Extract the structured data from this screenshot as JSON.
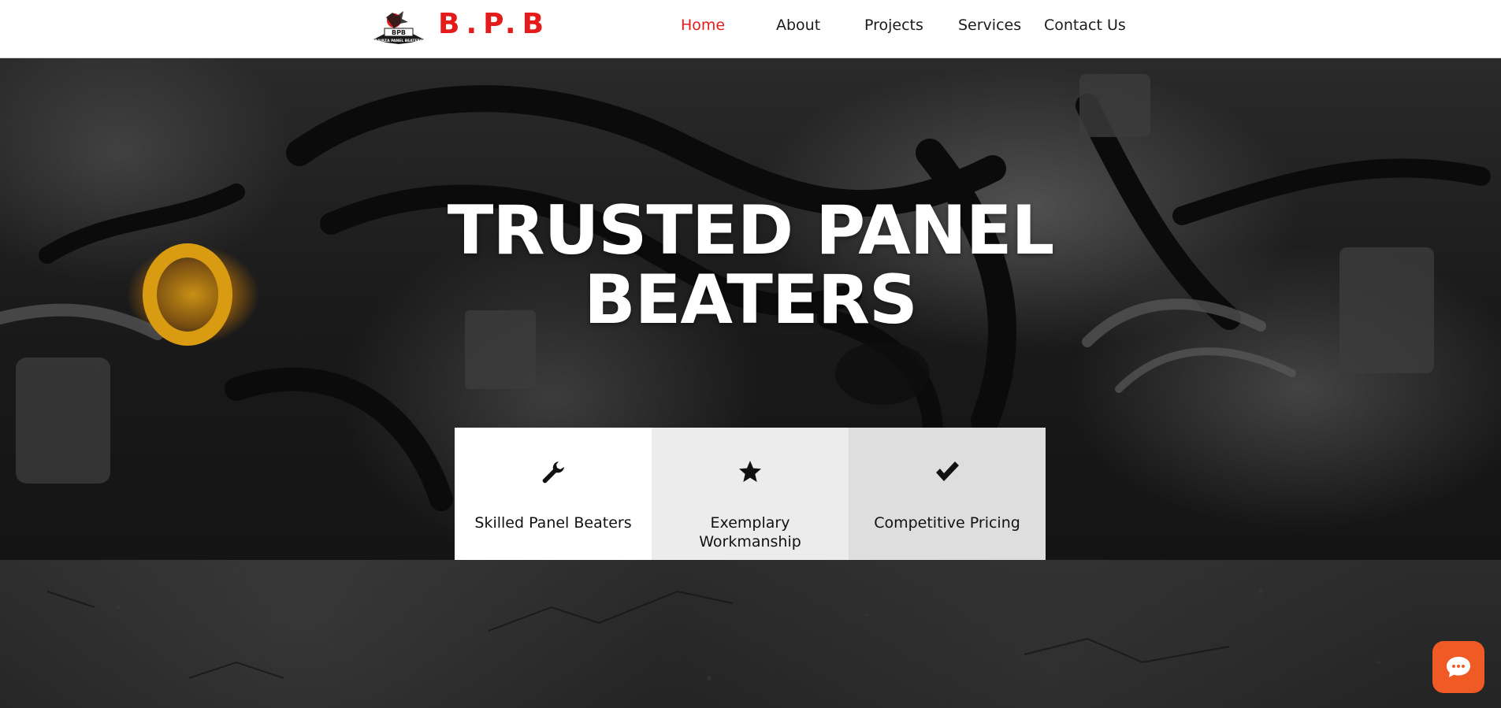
{
  "header": {
    "logo_alt": "BPB logo",
    "logo_text": "BPB",
    "logo_subtext": "BAIRZA PANEL BEATERS",
    "brand": "B.P.B",
    "brand_color": "#e41b1b",
    "nav": [
      {
        "label": "Home",
        "active": true
      },
      {
        "label": "About",
        "active": false
      },
      {
        "label": "Projects",
        "active": false
      },
      {
        "label": "Services",
        "active": false
      },
      {
        "label": "Contact Us",
        "active": false
      }
    ]
  },
  "hero": {
    "title_line1": "TRUSTED PANEL",
    "title_line2": "BEATERS"
  },
  "features": [
    {
      "icon": "wrench-icon",
      "label": "Skilled Panel Beaters"
    },
    {
      "icon": "star-icon",
      "label": "Exemplary Workmanship"
    },
    {
      "icon": "checkmark-icon",
      "label": "Competitive Pricing"
    }
  ],
  "chat": {
    "icon": "chat-bubble-icon",
    "color": "#f05a24"
  }
}
